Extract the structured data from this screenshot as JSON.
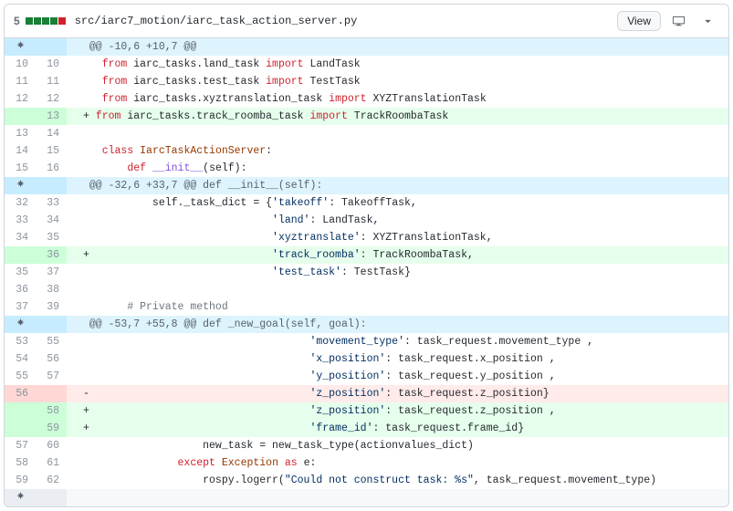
{
  "header": {
    "change_count": "5",
    "boxes": [
      "add",
      "add",
      "add",
      "add",
      "del"
    ],
    "file_path": "src/iarc7_motion/iarc_task_action_server.py",
    "view_label": "View"
  },
  "rows": [
    {
      "t": "hunk",
      "txt": " @@ -10,6 +10,7 @@"
    },
    {
      "t": "ctx",
      "l": "10",
      "r": "10",
      "seg": [
        {
          "c": "",
          "v": "   "
        },
        {
          "c": "kw-from",
          "v": "from"
        },
        {
          "c": "",
          "v": " iarc_tasks.land_task "
        },
        {
          "c": "kw-import",
          "v": "import"
        },
        {
          "c": "",
          "v": " LandTask"
        }
      ]
    },
    {
      "t": "ctx",
      "l": "11",
      "r": "11",
      "seg": [
        {
          "c": "",
          "v": "   "
        },
        {
          "c": "kw-from",
          "v": "from"
        },
        {
          "c": "",
          "v": " iarc_tasks.test_task "
        },
        {
          "c": "kw-import",
          "v": "import"
        },
        {
          "c": "",
          "v": " TestTask"
        }
      ]
    },
    {
      "t": "ctx",
      "l": "12",
      "r": "12",
      "seg": [
        {
          "c": "",
          "v": "   "
        },
        {
          "c": "kw-from",
          "v": "from"
        },
        {
          "c": "",
          "v": " iarc_tasks.xyztranslation_task "
        },
        {
          "c": "kw-import",
          "v": "import"
        },
        {
          "c": "",
          "v": " XYZTranslationTask"
        }
      ]
    },
    {
      "t": "add",
      "l": "",
      "r": "13",
      "seg": [
        {
          "c": "",
          "v": "+ "
        },
        {
          "c": "kw-from",
          "v": "from"
        },
        {
          "c": "",
          "v": " iarc_tasks.track_roomba_task "
        },
        {
          "c": "kw-import",
          "v": "import"
        },
        {
          "c": "",
          "v": " TrackRoombaTask"
        }
      ]
    },
    {
      "t": "ctx",
      "l": "13",
      "r": "14",
      "seg": [
        {
          "c": "",
          "v": " "
        }
      ]
    },
    {
      "t": "ctx",
      "l": "14",
      "r": "15",
      "seg": [
        {
          "c": "",
          "v": "   "
        },
        {
          "c": "kw-class",
          "v": "class"
        },
        {
          "c": "",
          "v": " "
        },
        {
          "c": "cls",
          "v": "IarcTaskActionServer"
        },
        {
          "c": "",
          "v": ":"
        }
      ]
    },
    {
      "t": "ctx",
      "l": "15",
      "r": "16",
      "seg": [
        {
          "c": "",
          "v": "       "
        },
        {
          "c": "kw-def",
          "v": "def"
        },
        {
          "c": "",
          "v": " "
        },
        {
          "c": "fn",
          "v": "__init__"
        },
        {
          "c": "",
          "v": "("
        },
        {
          "c": "self",
          "v": "self"
        },
        {
          "c": "",
          "v": "):"
        }
      ]
    },
    {
      "t": "hunk",
      "txt": " @@ -32,6 +33,7 @@ def __init__(self):"
    },
    {
      "t": "ctx",
      "l": "32",
      "r": "33",
      "seg": [
        {
          "c": "",
          "v": "           "
        },
        {
          "c": "self",
          "v": "self"
        },
        {
          "c": "",
          "v": "._task_dict = {"
        },
        {
          "c": "str",
          "v": "'takeoff'"
        },
        {
          "c": "",
          "v": ": TakeoffTask,"
        }
      ]
    },
    {
      "t": "ctx",
      "l": "33",
      "r": "34",
      "seg": [
        {
          "c": "",
          "v": "                              "
        },
        {
          "c": "str",
          "v": "'land'"
        },
        {
          "c": "",
          "v": ": LandTask,"
        }
      ]
    },
    {
      "t": "ctx",
      "l": "34",
      "r": "35",
      "seg": [
        {
          "c": "",
          "v": "                              "
        },
        {
          "c": "str",
          "v": "'xyztranslate'"
        },
        {
          "c": "",
          "v": ": XYZTranslationTask,"
        }
      ]
    },
    {
      "t": "add",
      "l": "",
      "r": "36",
      "seg": [
        {
          "c": "",
          "v": "+                             "
        },
        {
          "c": "str",
          "v": "'track_roomba'"
        },
        {
          "c": "",
          "v": ": TrackRoombaTask,"
        }
      ]
    },
    {
      "t": "ctx",
      "l": "35",
      "r": "37",
      "seg": [
        {
          "c": "",
          "v": "                              "
        },
        {
          "c": "str",
          "v": "'test_task'"
        },
        {
          "c": "",
          "v": ": TestTask}"
        }
      ]
    },
    {
      "t": "ctx",
      "l": "36",
      "r": "38",
      "seg": [
        {
          "c": "",
          "v": " "
        }
      ]
    },
    {
      "t": "ctx",
      "l": "37",
      "r": "39",
      "seg": [
        {
          "c": "",
          "v": "       "
        },
        {
          "c": "cmt",
          "v": "# Private method"
        }
      ]
    },
    {
      "t": "hunk",
      "txt": " @@ -53,7 +55,8 @@ def _new_goal(self, goal):"
    },
    {
      "t": "ctx",
      "l": "53",
      "r": "55",
      "seg": [
        {
          "c": "",
          "v": "                                    "
        },
        {
          "c": "str",
          "v": "'movement_type'"
        },
        {
          "c": "",
          "v": ": task_request.movement_type ,"
        }
      ]
    },
    {
      "t": "ctx",
      "l": "54",
      "r": "56",
      "seg": [
        {
          "c": "",
          "v": "                                    "
        },
        {
          "c": "str",
          "v": "'x_position'"
        },
        {
          "c": "",
          "v": ": task_request.x_position ,"
        }
      ]
    },
    {
      "t": "ctx",
      "l": "55",
      "r": "57",
      "seg": [
        {
          "c": "",
          "v": "                                    "
        },
        {
          "c": "str",
          "v": "'y_position'"
        },
        {
          "c": "",
          "v": ": task_request.y_position ,"
        }
      ]
    },
    {
      "t": "del",
      "l": "56",
      "r": "",
      "seg": [
        {
          "c": "",
          "v": "-                                   "
        },
        {
          "c": "str",
          "v": "'z_position'"
        },
        {
          "c": "",
          "v": ": task_request.z_position}"
        }
      ]
    },
    {
      "t": "add",
      "l": "",
      "r": "58",
      "seg": [
        {
          "c": "",
          "v": "+                                   "
        },
        {
          "c": "str",
          "v": "'z_position'"
        },
        {
          "c": "",
          "v": ": task_request.z_position ,"
        }
      ]
    },
    {
      "t": "add",
      "l": "",
      "r": "59",
      "seg": [
        {
          "c": "",
          "v": "+                                   "
        },
        {
          "c": "str",
          "v": "'frame_id'"
        },
        {
          "c": "",
          "v": ": task_request.frame_id}"
        }
      ]
    },
    {
      "t": "ctx",
      "l": "57",
      "r": "60",
      "seg": [
        {
          "c": "",
          "v": "                   new_task = new_task_type(actionvalues_dict)"
        }
      ]
    },
    {
      "t": "ctx",
      "l": "58",
      "r": "61",
      "seg": [
        {
          "c": "",
          "v": "               "
        },
        {
          "c": "kw-except",
          "v": "except"
        },
        {
          "c": "",
          "v": " "
        },
        {
          "c": "cls",
          "v": "Exception"
        },
        {
          "c": "",
          "v": " "
        },
        {
          "c": "kw-as",
          "v": "as"
        },
        {
          "c": "",
          "v": " e:"
        }
      ]
    },
    {
      "t": "ctx",
      "l": "59",
      "r": "62",
      "seg": [
        {
          "c": "",
          "v": "                   rospy.logerr("
        },
        {
          "c": "str",
          "v": "\"Could not construct task: %s\""
        },
        {
          "c": "",
          "v": ", task_request.movement_type)"
        }
      ]
    },
    {
      "t": "expand",
      "txt": ""
    }
  ]
}
